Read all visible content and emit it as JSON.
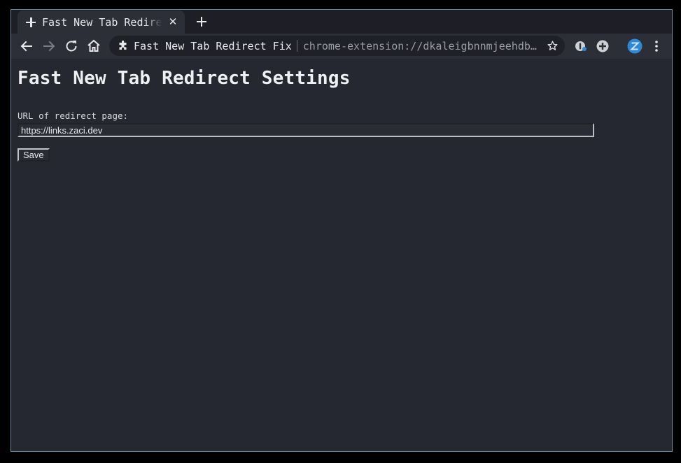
{
  "browser": {
    "tab": {
      "title": "Fast New Tab Redirect Fix",
      "icon": "puzzle-plus-icon",
      "close_glyph": "✕"
    },
    "new_tab_icon": "plus-icon",
    "toolbar": {
      "back_icon": "back-arrow-icon",
      "forward_icon": "forward-arrow-icon",
      "reload_icon": "reload-icon",
      "home_icon": "home-icon"
    },
    "omnibox": {
      "site_chip": "Fast New Tab Redirect Fix",
      "url": "chrome-extension://dkaleigbnnmjeehdbgkdlfmagkpmgoeg/options.html",
      "bookmark_icon": "star-icon"
    },
    "extensions": [
      {
        "name": "onepassword-icon",
        "color": "#cfd0d4"
      },
      {
        "name": "add-extension-icon",
        "color": "#cfd0d4"
      },
      {
        "name": "profile-avatar-icon",
        "color": "#2f88d6",
        "letter": "Z"
      }
    ],
    "menu_icon": "kebab-menu-icon"
  },
  "page": {
    "title": "Fast New Tab Redirect Settings",
    "field_label": "URL of redirect page:",
    "url_value": "https://links.zaci.dev",
    "save_label": "Save"
  },
  "colors": {
    "background": "#252731",
    "toolbar": "#2c2e38",
    "tabstrip": "#1e1f26",
    "text": "#e8e8ea",
    "avatar": "#2f88d6"
  }
}
